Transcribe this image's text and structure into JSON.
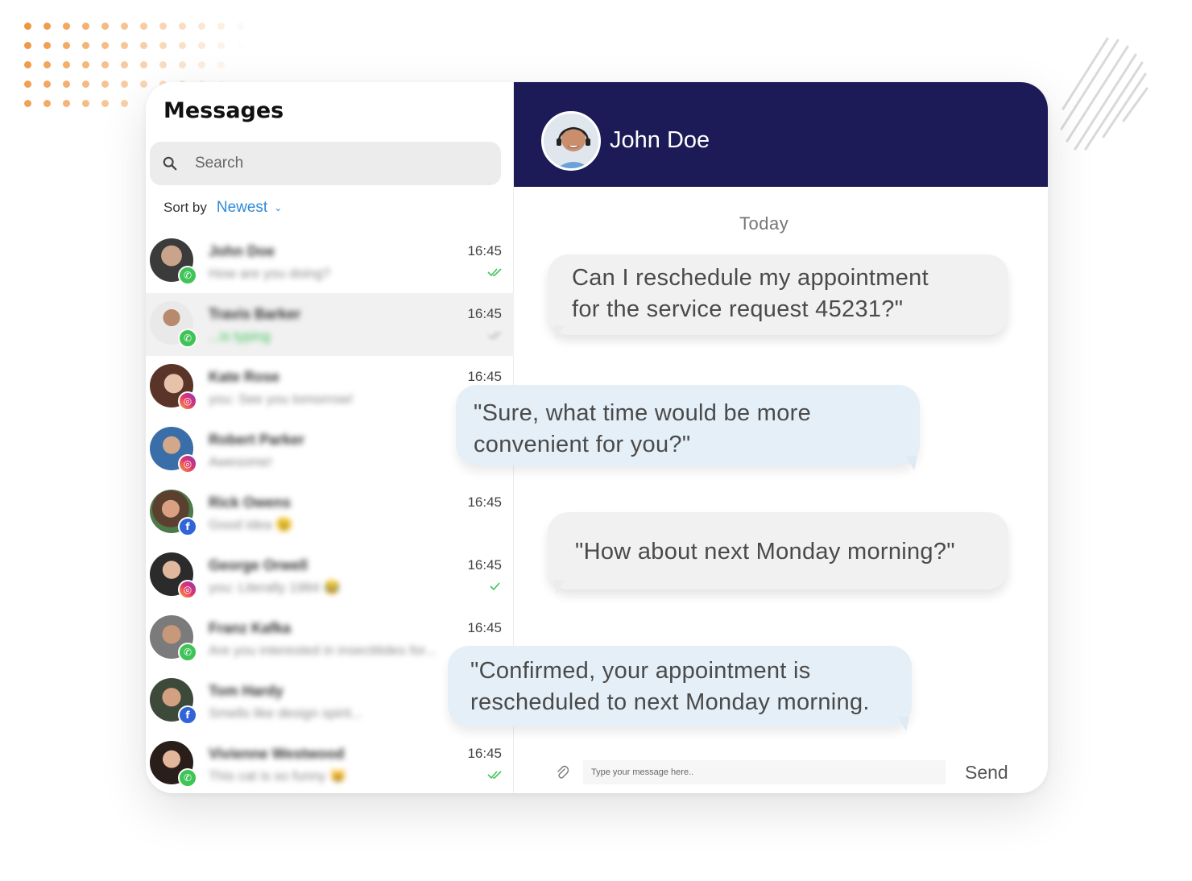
{
  "sidebar": {
    "title": "Messages",
    "search_placeholder": "Search",
    "sort_label": "Sort by",
    "sort_value": "Newest"
  },
  "conversations": [
    {
      "name": "John Doe",
      "preview": "How are you doing?",
      "time": "16:45",
      "channel": "whatsapp",
      "status": "read",
      "pinned": true
    },
    {
      "name": "Travis Barker",
      "preview": "...is typing",
      "time": "16:45",
      "channel": "whatsapp",
      "status": "read",
      "active": true
    },
    {
      "name": "Kate Rose",
      "preview": "you: See you tomorrow!",
      "time": "16:45",
      "channel": "instagram"
    },
    {
      "name": "Robert Parker",
      "preview": "Awesome!",
      "time": "",
      "channel": "instagram"
    },
    {
      "name": "Rick Owens",
      "preview": "Good idea 😉",
      "time": "16:45",
      "channel": "facebook"
    },
    {
      "name": "George Orwell",
      "preview": "you: Literally 1984 😂",
      "time": "16:45",
      "channel": "instagram",
      "status": "sent"
    },
    {
      "name": "Franz Kafka",
      "preview": "Are you interested in insectitides for...",
      "time": "16:45",
      "channel": "whatsapp"
    },
    {
      "name": "Tom Hardy",
      "preview": "Smells like design spirit...",
      "time": "",
      "channel": "facebook"
    },
    {
      "name": "Vivienne Westwood",
      "preview": "This cat is so funny 😸",
      "time": "16:45",
      "channel": "whatsapp",
      "status": "read"
    }
  ],
  "chat": {
    "contact_name": "John Doe",
    "day_label": "Today",
    "messages": [
      {
        "direction": "in",
        "text_line1": "Can I reschedule my appointment",
        "text_line2": "for the service request 45231?\""
      },
      {
        "direction": "out",
        "text_line1": "\"Sure, what time would be more",
        "text_line2": "convenient for you?\""
      },
      {
        "direction": "in",
        "text_line1": "\"How about next Monday morning?\"",
        "text_line2": ""
      },
      {
        "direction": "out",
        "text_line1": "\"Confirmed, your appointment is",
        "text_line2": "rescheduled to next Monday morning."
      }
    ],
    "composer_placeholder": "Type your message here..",
    "send_label": "Send"
  },
  "colors": {
    "header_bg": "#1c1b57",
    "accent_blue": "#2f8ad7",
    "whatsapp": "#3fc457",
    "facebook": "#3064d8",
    "dots": "#f0953f"
  },
  "icons": [
    "search-icon",
    "chevron-down-icon",
    "double-check-icon",
    "check-icon",
    "paperclip-icon",
    "whatsapp-icon",
    "instagram-icon",
    "facebook-icon"
  ]
}
